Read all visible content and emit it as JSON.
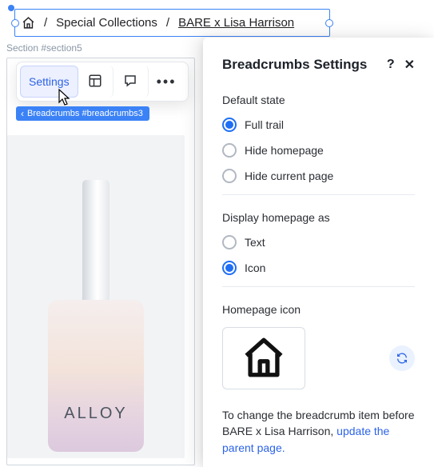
{
  "breadcrumb": {
    "items": [
      "Special Collections",
      "BARE x Lisa Harrison"
    ],
    "separator": "/"
  },
  "section_label": "Section #section5",
  "floatbar": {
    "settings": "Settings"
  },
  "selection_tag": "Breadcrumbs #breadcrumbs3",
  "product": {
    "brand": "ALLOY"
  },
  "panel": {
    "title": "Breadcrumbs Settings",
    "help": "?",
    "close": "✕",
    "default_state": {
      "title": "Default state",
      "options": {
        "full_trail": "Full trail",
        "hide_homepage": "Hide homepage",
        "hide_current": "Hide current page"
      },
      "selected": "full_trail"
    },
    "display_home": {
      "title": "Display homepage as",
      "options": {
        "text": "Text",
        "icon": "Icon"
      },
      "selected": "icon"
    },
    "homepage_icon_label": "Homepage icon",
    "note_prefix": "To change the breadcrumb item before BARE x Lisa Harrison, ",
    "note_link": "update the parent page."
  }
}
